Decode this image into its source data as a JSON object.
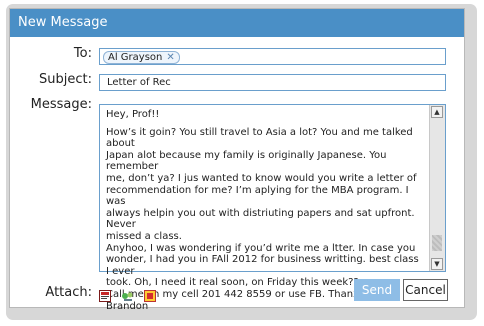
{
  "window": {
    "title": "New Message"
  },
  "to": {
    "label": "To:",
    "recipients": [
      "Al Grayson"
    ],
    "remove_glyph": "✕"
  },
  "subject": {
    "label": "Subject:",
    "value": "Letter of Rec"
  },
  "message": {
    "label": "Message:",
    "lines": [
      "Hey, Prof!!",
      "",
      "How’s it goin? You still travel to Asia a lot? You and me talked about",
      "Japan alot because my family is originally Japanese. You remember",
      "me, don’t ya? I jus wanted to know would you write a letter of",
      "recommendation for me? I’m aplying for the MBA program. I was",
      "always helpin you out with distriuting papers and sat upfront. Never",
      "missed a class.",
      "Anyhoo, I was wondering if you’d write me a ltter. In case you",
      "wonder, I had you in FAll 2012 for business writting. best class I ever",
      "took. Oh, I need it real soon, on Friday this week??",
      "Call me on my cell 201 442 8559 or use FB. Thanx.",
      "Brandon"
    ]
  },
  "attach": {
    "label": "Attach:",
    "icons": [
      "document-attach-icon",
      "image-attach-icon",
      "file-attach-icon"
    ]
  },
  "buttons": {
    "send": "Send",
    "cancel": "Cancel"
  },
  "colors": {
    "titlebar": "#4a8fc6",
    "send": "#8ebde6",
    "field_border": "#6a9fcc"
  }
}
